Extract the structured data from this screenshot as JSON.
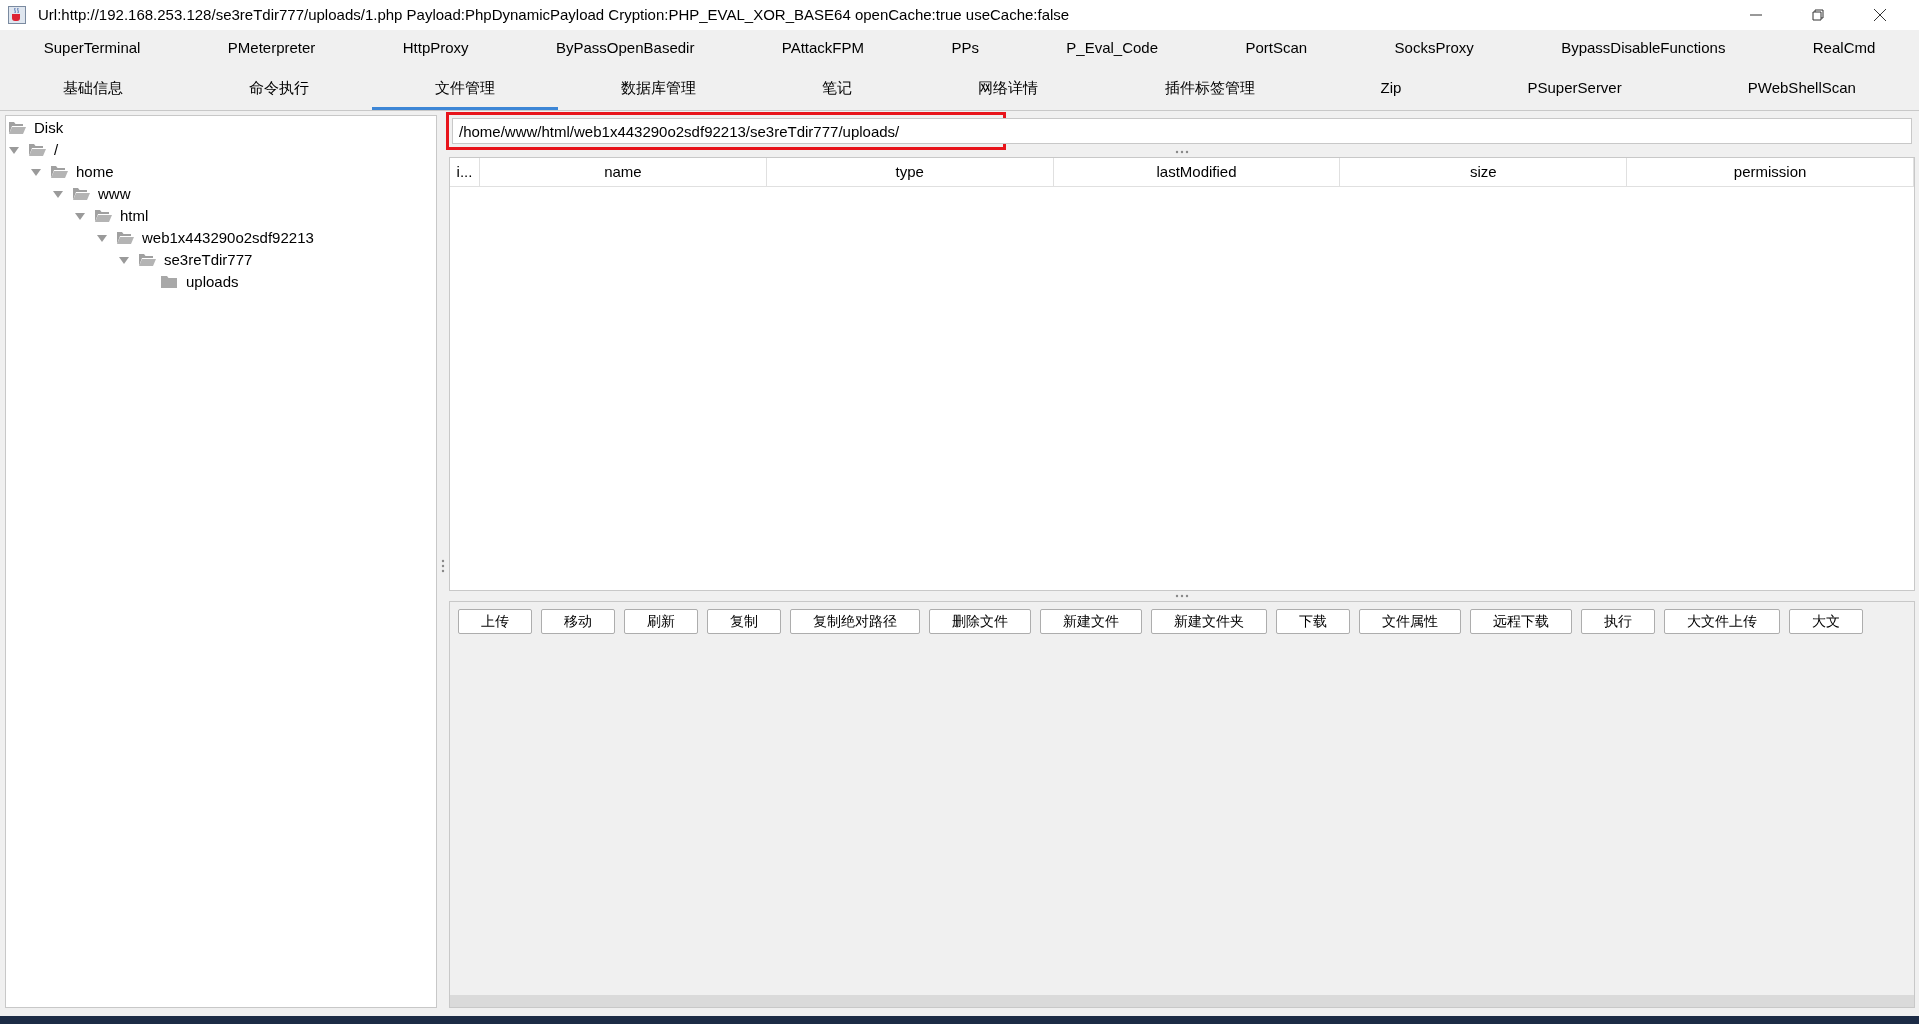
{
  "window": {
    "title": "Url:http://192.168.253.128/se3reTdir777/uploads/1.php Payload:PhpDynamicPayload Cryption:PHP_EVAL_XOR_BASE64 openCache:true useCache:false"
  },
  "tabs_row_1": [
    {
      "label": "SuperTerminal",
      "selected": false
    },
    {
      "label": "PMeterpreter",
      "selected": false
    },
    {
      "label": "HttpProxy",
      "selected": false
    },
    {
      "label": "ByPassOpenBasedir",
      "selected": false
    },
    {
      "label": "PAttackFPM",
      "selected": false
    },
    {
      "label": "PPs",
      "selected": false
    },
    {
      "label": "P_Eval_Code",
      "selected": false
    },
    {
      "label": "PortScan",
      "selected": false
    },
    {
      "label": "SocksProxy",
      "selected": false
    },
    {
      "label": "BypassDisableFunctions",
      "selected": false
    },
    {
      "label": "RealCmd",
      "selected": false
    }
  ],
  "tabs_row_2": [
    {
      "label": "基础信息",
      "selected": false
    },
    {
      "label": "命令执行",
      "selected": false
    },
    {
      "label": "文件管理",
      "selected": true
    },
    {
      "label": "数据库管理",
      "selected": false
    },
    {
      "label": "笔记",
      "selected": false
    },
    {
      "label": "网络详情",
      "selected": false
    },
    {
      "label": "插件标签管理",
      "selected": false
    },
    {
      "label": "Zip",
      "selected": false
    },
    {
      "label": "PSuperServer",
      "selected": false
    },
    {
      "label": "PWebShellScan",
      "selected": false
    }
  ],
  "tree": [
    {
      "label": "Disk"
    },
    {
      "label": "/",
      "expanded": true,
      "children": [
        {
          "label": "home",
          "expanded": true,
          "children": [
            {
              "label": "www",
              "expanded": true,
              "children": [
                {
                  "label": "html",
                  "expanded": true,
                  "children": [
                    {
                      "label": "web1x443290o2sdf92213",
                      "expanded": true,
                      "children": [
                        {
                          "label": "se3reTdir777",
                          "expanded": true,
                          "children": [
                            {
                              "label": "uploads"
                            }
                          ]
                        }
                      ]
                    }
                  ]
                }
              ]
            }
          ]
        }
      ]
    }
  ],
  "path_field": {
    "value": "/home/www/html/web1x443290o2sdf92213/se3reTdir777/uploads/",
    "highlighted": true
  },
  "table": {
    "columns": [
      "i...",
      "name",
      "type",
      "lastModified",
      "size",
      "permission"
    ]
  },
  "buttons": [
    "上传",
    "移动",
    "刷新",
    "复制",
    "复制绝对路径",
    "删除文件",
    "新建文件",
    "新建文件夹",
    "下载",
    "文件属性",
    "远程下载",
    "执行",
    "大文件上传",
    "大文"
  ]
}
